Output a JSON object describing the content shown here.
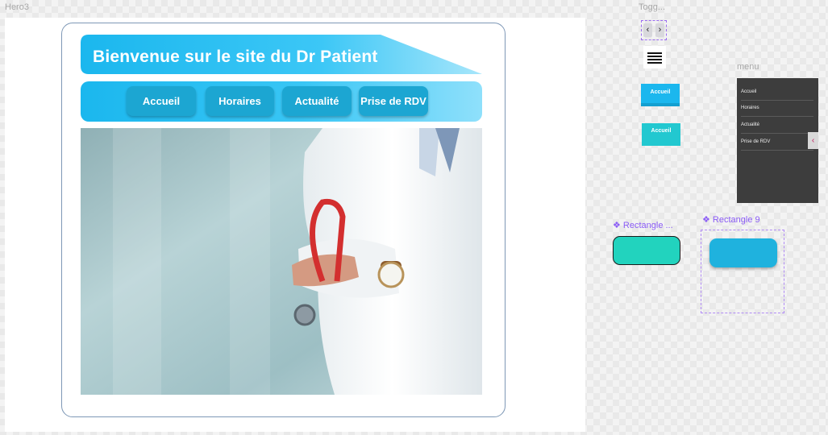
{
  "canvas": {
    "frame_label": "Hero3",
    "toggle_label": "Togg...",
    "menu_label": "menu",
    "rect_left_label": "❖ Rectangle ...",
    "rect_right_label": "❖ Rectangle 9"
  },
  "hero": {
    "title": "Bienvenue sur le site du Dr Patient",
    "nav": [
      "Accueil",
      "Horaires",
      "Actualité",
      "Prise de RDV"
    ]
  },
  "components": {
    "mini_button_1": "Accueil",
    "mini_button_2": "Accueil",
    "toggle_left_icon": "chevron-left-icon",
    "toggle_right_icon": "chevron-right-icon",
    "menu_items": [
      "Accueil",
      "Horaires",
      "Actualité",
      "Prise de RDV"
    ]
  },
  "colors": {
    "nav_button": "#1ca6d2",
    "banner_start": "#1bb7ee",
    "mini_blue": "#1bb7ee",
    "mini_teal": "#22c8d0",
    "rect_teal": "#22d3be",
    "rect_blue": "#1fb2de",
    "menu_bg": "#3d3d3d"
  }
}
